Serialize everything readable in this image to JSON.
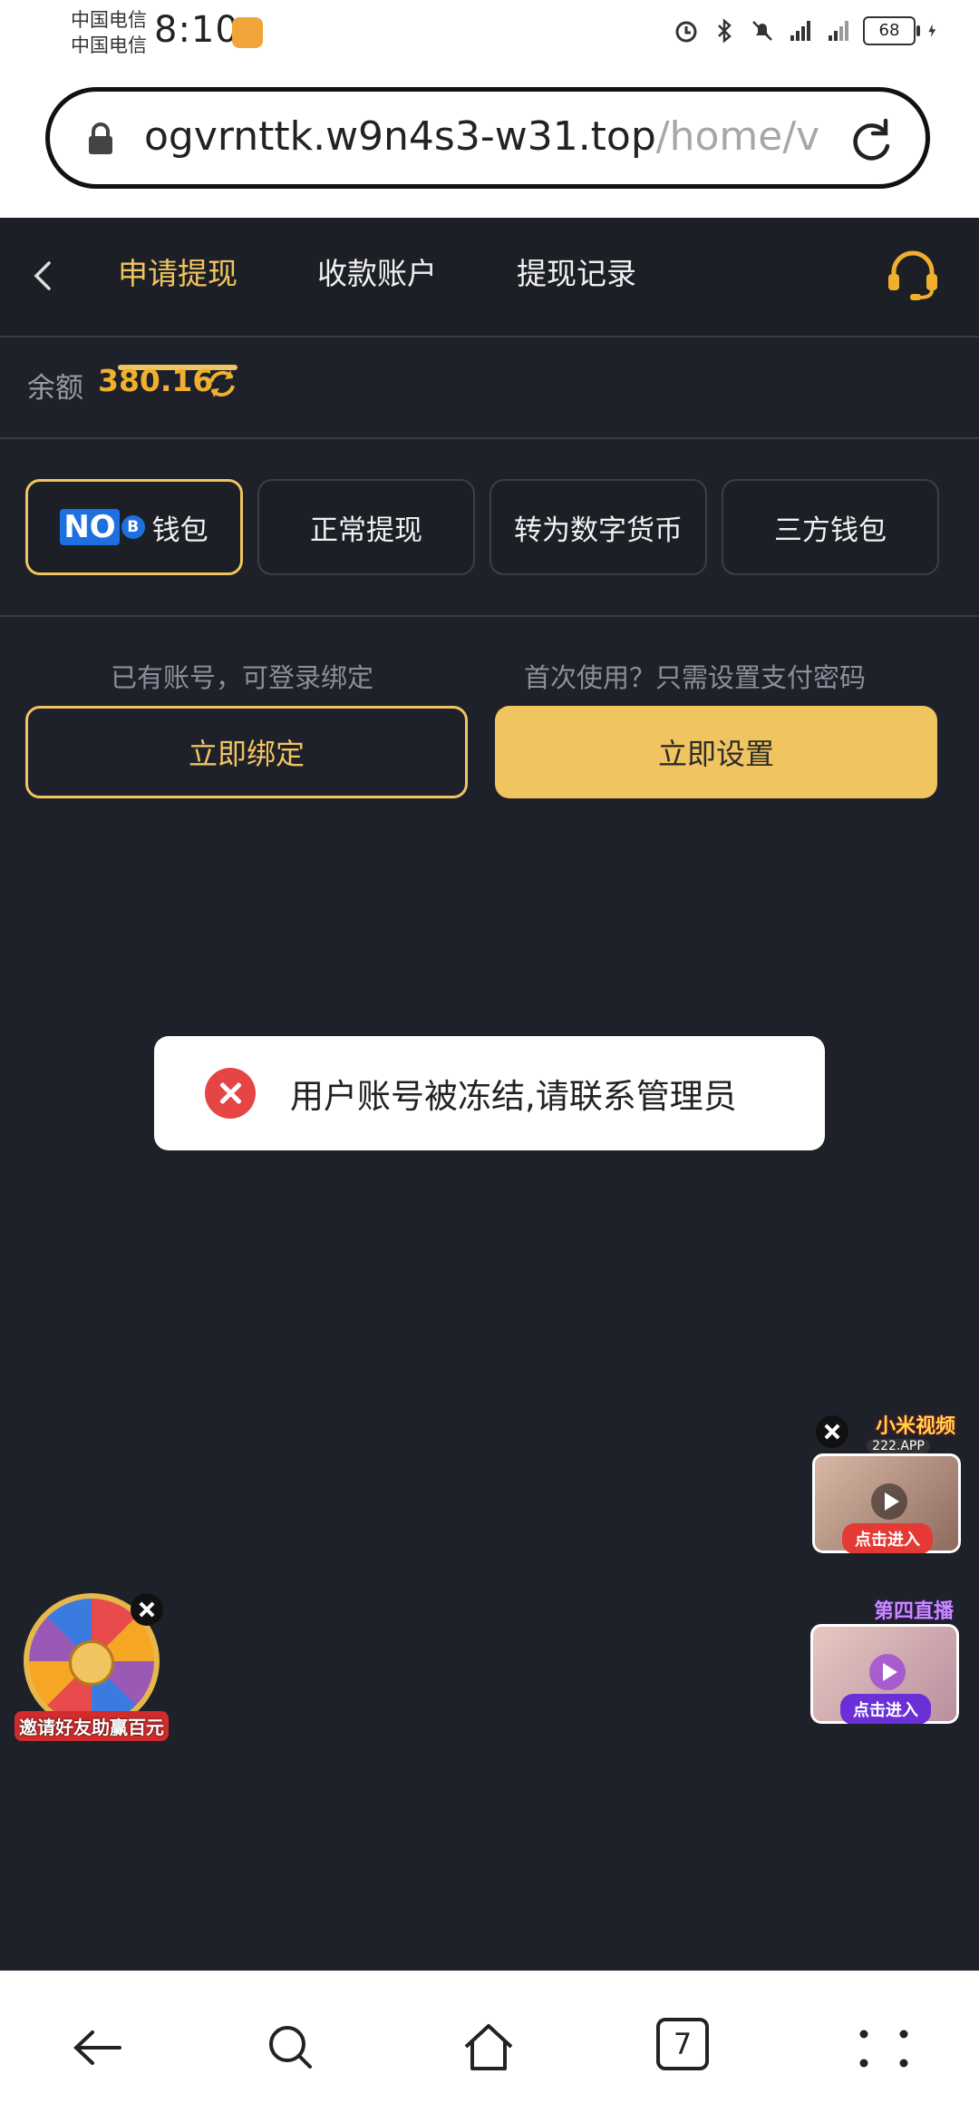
{
  "status_bar": {
    "carrier1": "中国电信",
    "carrier2": "中国电信",
    "time": "8:10",
    "battery": "68"
  },
  "browser": {
    "url_host": "ogvrnttk.w9n4s3-w31.top",
    "url_path": "/home/v"
  },
  "header": {
    "tabs": [
      {
        "label": "申请提现",
        "active": true
      },
      {
        "label": "收款账户",
        "active": false
      },
      {
        "label": "提现记录",
        "active": false
      }
    ]
  },
  "balance": {
    "label": "余额",
    "value": "380.16"
  },
  "methods": [
    {
      "label": "钱包",
      "logo": "NO",
      "active": true
    },
    {
      "label": "正常提现",
      "active": false
    },
    {
      "label": "转为数字货币",
      "active": false
    },
    {
      "label": "三方钱包",
      "active": false
    }
  ],
  "bind": {
    "hint_left": "已有账号，可登录绑定",
    "hint_right": "首次使用？只需设置支付密码",
    "bind_label": "立即绑定",
    "set_label": "立即设置"
  },
  "toast": {
    "message": "用户账号被冻结,请联系管理员"
  },
  "floats": {
    "wheel_label": "邀请好友助赢百元",
    "ad1_title": "小米视频",
    "ad1_sub": "222.APP",
    "ad1_btn": "点击进入",
    "ad2_title": "第四直播",
    "ad2_btn": "点击进入"
  },
  "bottom_nav": {
    "tab_count": "7"
  },
  "colors": {
    "accent": "#f0c45f",
    "background": "#1f212a",
    "balance": "#f0b02e",
    "error": "#e64545"
  }
}
